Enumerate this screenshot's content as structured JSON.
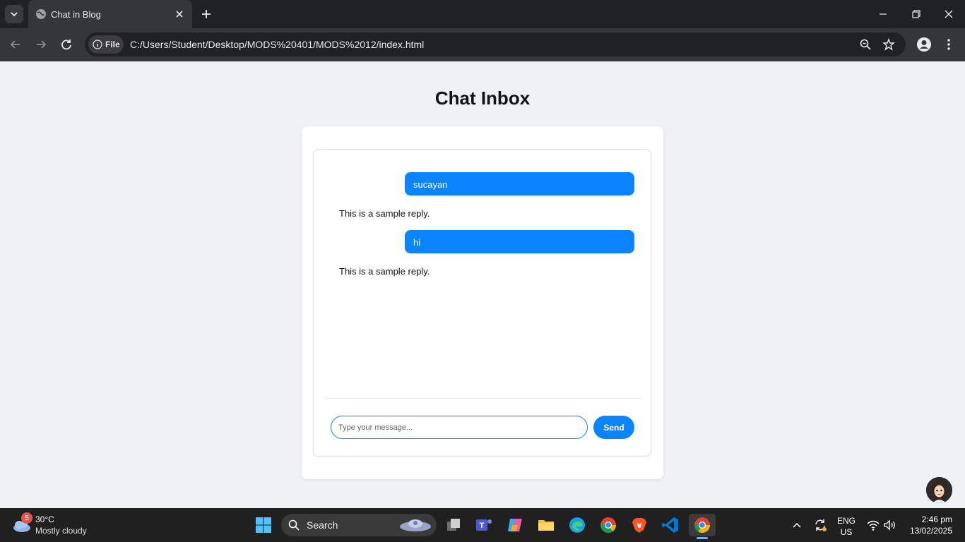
{
  "browser": {
    "tab_title": "Chat in Blog",
    "chip_label": "File",
    "url": "C:/Users/Student/Desktop/MODS%20401/MODS%2012/index.html"
  },
  "page": {
    "title": "Chat Inbox",
    "messages": [
      {
        "type": "sent",
        "text": "sucayan"
      },
      {
        "type": "reply",
        "text": "This is a sample reply."
      },
      {
        "type": "sent",
        "text": "hi"
      },
      {
        "type": "reply",
        "text": "This is a sample reply."
      }
    ],
    "input_placeholder": "Type your message...",
    "send_label": "Send"
  },
  "taskbar": {
    "weather_badge": "5",
    "weather_temp": "30°C",
    "weather_condition": "Mostly cloudy",
    "search_label": "Search",
    "lang_line1": "ENG",
    "lang_line2": "US",
    "time": "2:46 pm",
    "date": "13/02/2025"
  },
  "colors": {
    "accent": "#0a84ff",
    "page_bg": "#f0f1f5",
    "chrome_dark": "#202124",
    "chrome_toolbar": "#35363a"
  }
}
